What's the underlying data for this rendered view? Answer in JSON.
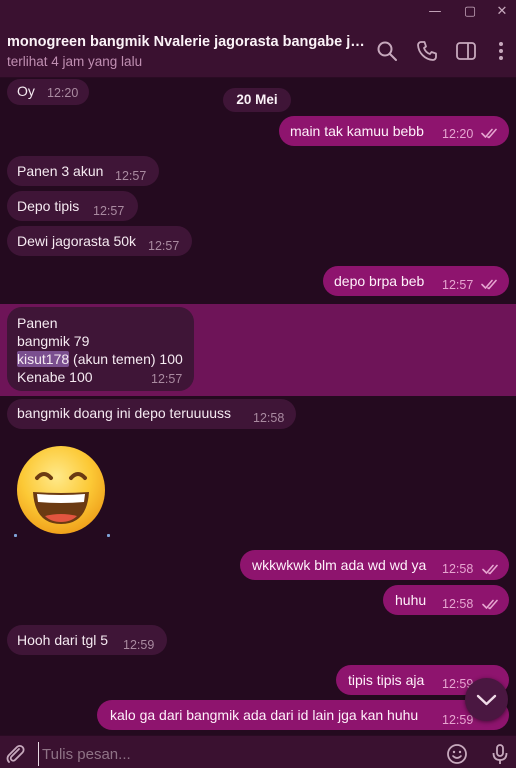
{
  "window": {
    "minimize": "—",
    "maximize": "▢",
    "close": "✕"
  },
  "header": {
    "title": "monogreen bangmik Nvalerie jagorasta bangabe jago...",
    "status": "terlihat 4 jam yang lalu",
    "icons": [
      "search-icon",
      "phone-icon",
      "sidebar-icon",
      "more-icon"
    ]
  },
  "date_separator": "20 Mei",
  "messages": [
    {
      "dir": "in",
      "text": "Oy",
      "time": "12:20"
    },
    {
      "dir": "out",
      "text": "main tak kamuu bebb",
      "time": "12:20",
      "read": true
    },
    {
      "dir": "in",
      "text": "Panen 3 akun",
      "time": "12:57"
    },
    {
      "dir": "in",
      "text": "Depo tipis",
      "time": "12:57"
    },
    {
      "dir": "in",
      "text": "Dewi jagorasta 50k",
      "time": "12:57"
    },
    {
      "dir": "out",
      "text": "depo brpa beb",
      "time": "12:57",
      "read": true
    },
    {
      "dir": "in",
      "lines": [
        "Panen",
        "bangmik 79",
        "kisut178",
        " (akun temen) 100",
        "Kenabe 100"
      ],
      "time": "12:57",
      "highlighted": "kisut178"
    },
    {
      "dir": "in",
      "text": "bangmik doang ini depo teruuuuss",
      "time": "12:58"
    },
    {
      "dir": "in",
      "sticker": "grinning-face-emoji"
    },
    {
      "dir": "out",
      "text": "wkkwkwk blm ada wd wd ya",
      "time": "12:58",
      "read": true
    },
    {
      "dir": "out",
      "text": "huhu",
      "time": "12:58",
      "read": true
    },
    {
      "dir": "in",
      "text": "Hooh dari tgl 5",
      "time": "12:59"
    },
    {
      "dir": "out",
      "text": "tipis tipis aja",
      "time": "12:59",
      "read": true
    },
    {
      "dir": "out",
      "text": "kalo ga dari bangmik ada dari id lain jga kan huhu",
      "time": "12:59",
      "read": true
    }
  ],
  "composer": {
    "placeholder": "Tulis pesan..."
  },
  "colors": {
    "background": "#240a1f",
    "header": "#3a1130",
    "incoming_bubble": "#3f1537",
    "outgoing_bubble": "#8e146e",
    "highlight_band": "#6e1458"
  }
}
